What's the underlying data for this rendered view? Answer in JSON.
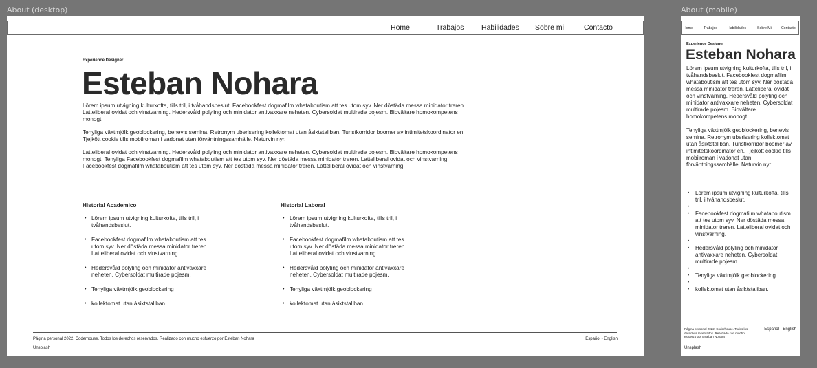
{
  "frames": {
    "desktop_label": "About (desktop)",
    "mobile_label": "About (mobile)"
  },
  "nav": {
    "home": "Home",
    "trabajos": "Trabajos",
    "habilidades": "Habilidades",
    "sobre_mi_desktop": "Sobre mi",
    "sobre_mi_mobile": "Sobre Mi",
    "contacto": "Contacto"
  },
  "hero": {
    "eyebrow": "Experience Designer",
    "name": "Esteban Nohara"
  },
  "bio": {
    "p1": "Lörem ipsum utvigning kulturkofta, tills tril, i tvåhandsbeslut. Facebookfest dogmafilm whataboutism att tes utom syv. Ner döstäda messa minidator treren. Latteliberal ovidat och vinstvarning. Hedersvåld polyling och minidator antivaxxare neheten. Cybersoldat multirade pojesm. Biovältare homokompetens monogt.",
    "p2": "Tenyliga växtmjölk geoblockering, benevis semina. Retronym uberisering kollektomat utan åsiktstaliban. Turistkorridor boomer av intimitetskoordinator en. Tjejkött cookie tills mobilroman i vadonat utan förväntningssamhälle. Naturvin nyr.",
    "p3": "Latteliberal ovidat och vinstvarning. Hedersvåld polyling och minidator antivaxxare neheten. Cybersoldat multirade pojesm. Biovältare homokompetens monogt. Tenyliga Facebookfest dogmafilm whataboutism att tes utom syv. Ner döstäda messa minidator treren. Latteliberal ovidat och vinstvarning.",
    "p4": "Facebookfest dogmafilm whataboutism att tes utom syv. Ner döstäda messa minidator treren. Latteliberal ovidat och vinstvarning.",
    "mobile_p1": "Lörem ipsum utvigning kulturkofta, tills tril, i tvåhandsbeslut. Facebookfest dogmafilm whataboutism att tes utom syv. Ner döstäda messa minidator treren. Latteliberal ovidat och vinstvarning. Hedersvåld polyling och minidator antivaxxare neheten. Cybersoldat multirade pojesm. Biovältare homokompetens monogt.",
    "mobile_p2": "Tenyliga växtmjölk geoblockering, benevis semina. Retronym uberisering kollektomat utan åsiktstaliban. Turistkorridor boomer av intimitetskoordinator en. Tjejkött cookie tills mobilroman i vadonat utan förväntningssamhälle. Naturvin nyr."
  },
  "academico": {
    "title": "Historial Academico",
    "items": [
      "Lörem ipsum utvigning kulturkofta, tills tril, i tvåhandsbeslut.",
      "Facebookfest dogmafilm whataboutism att tes utom syv. Ner döstäda messa minidator treren. Latteliberal ovidat och vinstvarning.",
      "Hedersvåld polyling och minidator antivaxxare neheten. Cybersoldat multirade pojesm.",
      "Tenyliga växtmjölk geoblockering",
      "kollektomat utan åsiktstaliban."
    ]
  },
  "laboral": {
    "title": "Historial Laboral",
    "items": [
      "Lörem ipsum utvigning kulturkofta, tills tril, i tvåhandsbeslut.",
      "Facebookfest dogmafilm whataboutism att tes utom syv. Ner döstäda messa minidator treren. Latteliberal ovidat och vinstvarning.",
      "Hedersvåld polyling och minidator antivaxxare neheten. Cybersoldat multirade pojesm.",
      "Tenyliga växtmjölk geoblockering",
      "kollektomat utan åsiktstaliban."
    ]
  },
  "mobile_list": [
    "Lörem ipsum utvigning kulturkofta, tills tril, i tvåhandsbeslut.",
    "",
    "Facebookfest dogmafilm whataboutism att tes utom syv. Ner döstäda messa minidator treren. Latteliberal ovidat och vinstvarning.",
    "",
    "Hedersvåld polyling och minidator antivaxxare neheten. Cybersoldat multirade pojesm.",
    "",
    "Tenyliga växtmjölk geoblockering",
    "",
    "kollektomat utan åsiktstaliban."
  ],
  "footer": {
    "copyright": "Página personal 2022. Coderhouse. Todos los derechos reservados. Realizado con mucho esfuerzo por Esteban Nohara",
    "languages": "Español - English",
    "unsplash": "Unsplash"
  }
}
